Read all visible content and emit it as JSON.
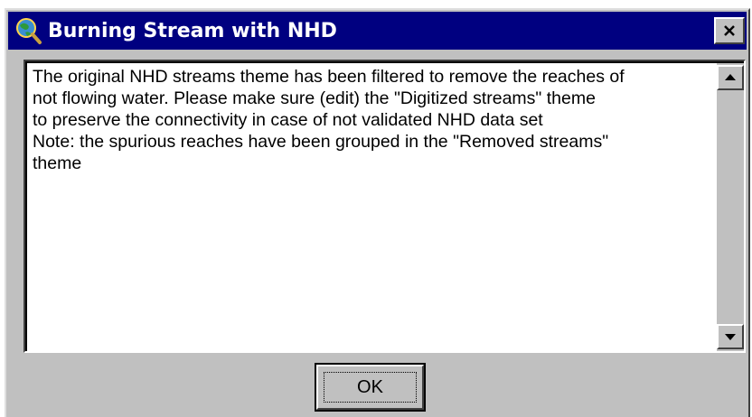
{
  "window": {
    "title": "Burning Stream with NHD",
    "app_icon": "globe-magnifier-icon",
    "close_label": "×"
  },
  "message": {
    "lines": [
      "The original NHD streams theme has been filtered to remove the reaches of",
      "not flowing water. Please make sure (edit) the \"Digitized streams\" theme",
      "to preserve the connectivity in case of not validated NHD data set",
      "Note: the spurious reaches have been grouped in the \"Removed streams\"",
      "theme"
    ]
  },
  "scrollbar": {
    "up_icon": "arrow-up-icon",
    "down_icon": "arrow-down-icon"
  },
  "buttons": {
    "ok_label": "OK"
  },
  "colors": {
    "titlebar": "#000080",
    "face": "#c0c0c0",
    "text_bg": "#ffffff"
  }
}
